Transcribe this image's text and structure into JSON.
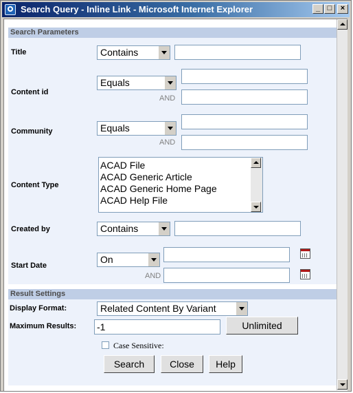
{
  "window": {
    "title": "Search Query - Inline Link - Microsoft Internet Explorer",
    "controls": {
      "minimize": "_",
      "maximize": "□",
      "close": "×"
    }
  },
  "sections": {
    "search_parameters": "Search Parameters",
    "result_settings": "Result Settings"
  },
  "fields": {
    "title": {
      "label": "Title",
      "operator": "Contains",
      "value": ""
    },
    "content_id": {
      "label": "Content id",
      "operator": "Equals",
      "and_label": "AND",
      "value1": "",
      "value2": ""
    },
    "community": {
      "label": "Community",
      "operator": "Equals",
      "and_label": "AND",
      "value1": "",
      "value2": ""
    },
    "content_type": {
      "label": "Content Type",
      "items": [
        "ACAD File",
        "ACAD Generic Article",
        "ACAD Generic Home Page",
        "ACAD Help File"
      ]
    },
    "created_by": {
      "label": "Created by",
      "operator": "Contains",
      "value": ""
    },
    "start_date": {
      "label": "Start Date",
      "operator": "On",
      "and_label": "AND",
      "value1": "",
      "value2": ""
    }
  },
  "results": {
    "display_format": {
      "label": "Display Format:",
      "value": "Related Content By Variant"
    },
    "maximum_results": {
      "label": "Maximum Results:",
      "value": "-1",
      "unlimited_button": "Unlimited"
    },
    "case_sensitive": "Case Sensitive:"
  },
  "buttons": {
    "search": "Search",
    "close": "Close",
    "help": "Help"
  }
}
